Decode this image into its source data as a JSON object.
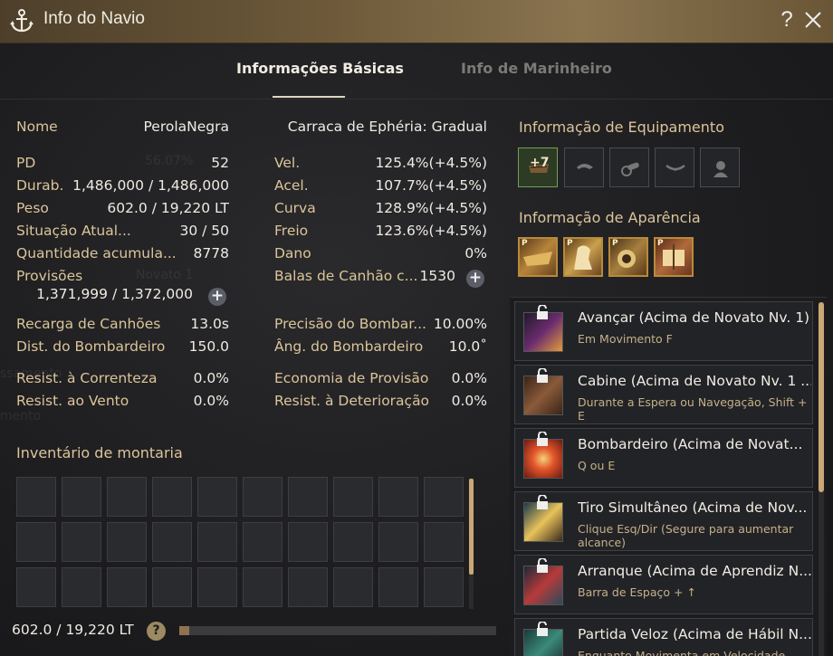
{
  "window": {
    "title": "Info do Navio",
    "help": "?"
  },
  "tabs": [
    {
      "label": "Informações Básicas",
      "active": true
    },
    {
      "label": "Info de Marinheiro",
      "active": false
    }
  ],
  "ship": {
    "name_label": "Nome",
    "name_value": "PerolaNegra",
    "type": "Carraca de Ephéria: Gradual"
  },
  "stats_left": [
    {
      "label": "PD",
      "value": "52"
    },
    {
      "label": "Durab.",
      "value": "1,486,000 / 1,486,000"
    },
    {
      "label": "Peso",
      "value": "602.0 / 19,220 LT"
    },
    {
      "label": "Situação Atual...",
      "value": "30 / 50"
    },
    {
      "label": "Quantidade acumula...",
      "value": "8778"
    },
    {
      "label": "Provisões",
      "value": "1,371,999 / 1,372,000"
    }
  ],
  "stats_right": [
    {
      "label": "Vel.",
      "value": "125.4%(+4.5%)"
    },
    {
      "label": "Acel.",
      "value": "107.7%(+4.5%)"
    },
    {
      "label": "Curva",
      "value": "128.9%(+4.5%)"
    },
    {
      "label": "Freio",
      "value": "123.6%(+4.5%)"
    },
    {
      "label": "Dano",
      "value": "0%"
    },
    {
      "label": "Balas de Canhão c...",
      "value": "1530"
    }
  ],
  "stats_mid_left": [
    {
      "label": "Recarga de Canhões",
      "value": "13.0s"
    },
    {
      "label": "Dist. do Bombardeiro",
      "value": "150.0"
    }
  ],
  "stats_mid_right": [
    {
      "label": "Precisão do Bombar...",
      "value": "10.00%"
    },
    {
      "label": "Âng. do Bombardeiro",
      "value": "10.0˚"
    }
  ],
  "stats_res_left": [
    {
      "label": "Resist. à Correnteza",
      "value": "0.0%"
    },
    {
      "label": "Resist. ao Vento",
      "value": "0.0%"
    }
  ],
  "stats_res_right": [
    {
      "label": "Economia de Provisão",
      "value": "0.0%"
    },
    {
      "label": "Resist. à Deterioração",
      "value": "0.0%"
    }
  ],
  "inventory": {
    "title": "Inventário de montaria",
    "weight": "602.0 / 19,220 LT",
    "weight_fraction": 0.031,
    "help": "?"
  },
  "equipment": {
    "title": "Informação de Equipamento",
    "first_slot_badge": "+7",
    "slot_icons": [
      "hull-icon",
      "figurehead-icon",
      "cannon-icon",
      "sail-icon",
      "crew-icon"
    ]
  },
  "appearance": {
    "title": "Informação de Aparência",
    "badge": "P"
  },
  "skills": [
    {
      "name": "Avançar (Acima de Novato Nv. 1)",
      "desc": "Em Movimento F"
    },
    {
      "name": "Cabine (Acima de Novato Nv. 1 ...",
      "desc": "Durante a Espera ou Navegação, Shift + E"
    },
    {
      "name": "Bombardeiro (Acima de Novat...",
      "desc": "Q ou E"
    },
    {
      "name": "Tiro Simultâneo (Acima de Nov...",
      "desc": "Clique Esq/Dir (Segure para aumentar alcance)"
    },
    {
      "name": "Arranque (Acima de Aprendiz N...",
      "desc": "Barra de Espaço + ↑"
    },
    {
      "name": "Partida Veloz (Acima de Hábil N...",
      "desc": "Enquanto Movimenta em Velocidade"
    }
  ],
  "colors": {
    "accent": "#dcc49a",
    "gold": "#c9a777",
    "title_bar": "#6e5a3a"
  }
}
